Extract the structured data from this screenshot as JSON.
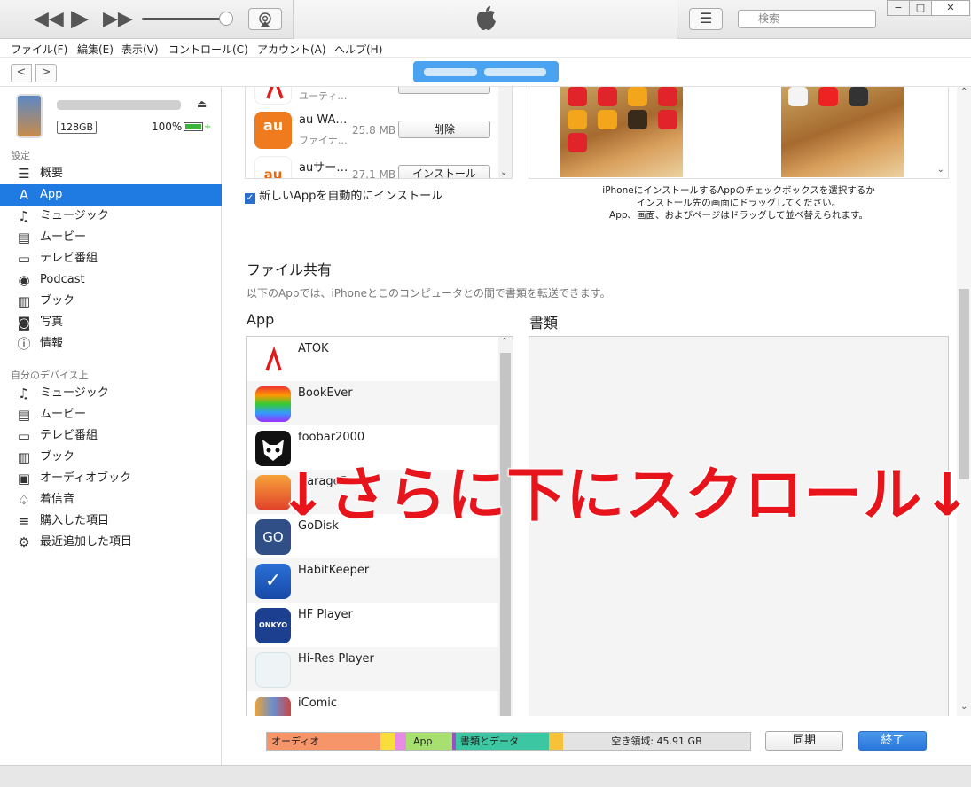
{
  "toolbar": {
    "search_placeholder": "検索",
    "win_min": "−",
    "win_max": "□",
    "win_close": "✕"
  },
  "menu": [
    "ファイル(F)",
    "編集(E)",
    "表示(V)",
    "コントロール(C)",
    "アカウント(A)",
    "ヘルプ(H)"
  ],
  "device": {
    "capacity": "128GB",
    "battery": "100%"
  },
  "sidebar": {
    "settings_header": "設定",
    "settings_items": [
      {
        "label": "概要",
        "icon": "summary-icon"
      },
      {
        "label": "App",
        "icon": "app-store-icon"
      },
      {
        "label": "ミュージック",
        "icon": "music-note-icon"
      },
      {
        "label": "ムービー",
        "icon": "film-icon"
      },
      {
        "label": "テレビ番組",
        "icon": "tv-icon"
      },
      {
        "label": "Podcast",
        "icon": "podcast-icon"
      },
      {
        "label": "ブック",
        "icon": "book-icon"
      },
      {
        "label": "写真",
        "icon": "camera-icon"
      },
      {
        "label": "情報",
        "icon": "info-icon"
      }
    ],
    "mydevice_header": "自分のデバイス上",
    "mydevice_items": [
      {
        "label": "ミュージック",
        "icon": "music-note-icon"
      },
      {
        "label": "ムービー",
        "icon": "film-icon"
      },
      {
        "label": "テレビ番組",
        "icon": "tv-icon"
      },
      {
        "label": "ブック",
        "icon": "book-icon"
      },
      {
        "label": "オーディオブック",
        "icon": "audiobook-icon"
      },
      {
        "label": "着信音",
        "icon": "bell-icon"
      },
      {
        "label": "購入した項目",
        "icon": "purchased-list-icon"
      },
      {
        "label": "最近追加した項目",
        "icon": "gear-icon"
      }
    ]
  },
  "top_apps": [
    {
      "name": "",
      "category": "ユーティ…",
      "size": "",
      "button": ""
    },
    {
      "name": "au WA…",
      "category": "ファイナ…",
      "size": "25.8 MB",
      "button": "削除"
    },
    {
      "name": "auサー…",
      "category": "",
      "size": "27.1 MB",
      "button": "インストール"
    }
  ],
  "auto_install": "新しいAppを自動的にインストール",
  "screens_hint": [
    "iPhoneにインストールするAppのチェックボックスを選択するか",
    "インストール先の画面にドラッグしてください。",
    "App、画面、およびページはドラッグして並べ替えられます。"
  ],
  "file_sharing": {
    "title": "ファイル共有",
    "description": "以下のAppでは、iPhoneとこのコンピュータとの間で書類を転送できます。",
    "app_header": "App",
    "docs_header": "書類",
    "apps": [
      "ATOK",
      "BookEver",
      "foobar2000",
      "GarageBand",
      "GoDisk",
      "HabitKeeper",
      "HF Player",
      "Hi-Res Player",
      "iComic"
    ]
  },
  "overlay_text": "↓さらに下にスクロール↓",
  "capacity_bar": {
    "audio": "オーディオ",
    "app": "App",
    "docs": "書類とデータ",
    "free": "空き領域: 45.91 GB"
  },
  "buttons": {
    "sync": "同期",
    "done": "終了"
  }
}
